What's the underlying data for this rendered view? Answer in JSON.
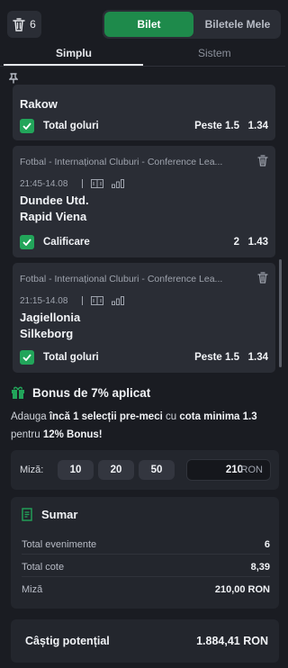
{
  "header": {
    "selections_count": "6",
    "toggle": {
      "active": "Bilet",
      "inactive": "Biletele Mele"
    }
  },
  "tabs": {
    "simple": "Simplu",
    "system": "Sistem"
  },
  "bets": [
    {
      "team1": "Rakow",
      "market": "Total goluri",
      "pick": "Peste 1.5",
      "odd": "1.34"
    },
    {
      "league": "Fotbal - Internațional Cluburi - Conference Lea...",
      "time": "21:45-14.08",
      "team1": "Dundee Utd.",
      "team2": "Rapid Viena",
      "market": "Calificare",
      "pick": "2",
      "odd": "1.43"
    },
    {
      "league": "Fotbal - Internațional Cluburi - Conference Lea...",
      "time": "21:15-14.08",
      "team1": "Jagiellonia",
      "team2": "Silkeborg",
      "market": "Total goluri",
      "pick": "Peste 1.5",
      "odd": "1.34"
    }
  ],
  "bonus": {
    "title": "Bonus de 7% aplicat",
    "t1": "Adauga ",
    "t2": "încă 1 selecții pre-meci",
    "t3": " cu ",
    "t4": "cota minima 1.3",
    "t5": " pentru ",
    "t6": "12% Bonus!"
  },
  "stake": {
    "label": "Miză:",
    "chips": [
      "10",
      "20",
      "50"
    ],
    "value": "210",
    "currency": "RON"
  },
  "summary": {
    "title": "Sumar",
    "rows": [
      {
        "label": "Total evenimente",
        "value": "6"
      },
      {
        "label": "Total cote",
        "value": "8,39"
      },
      {
        "label": "Miză",
        "value": "210,00 RON"
      }
    ]
  },
  "payout": {
    "label": "Câștig potențial",
    "value": "1.884,41 RON"
  },
  "colors": {
    "accent": "#1e8a4b",
    "check": "#22a55a",
    "bg": "#1a1c22",
    "card": "#2a2d35"
  }
}
